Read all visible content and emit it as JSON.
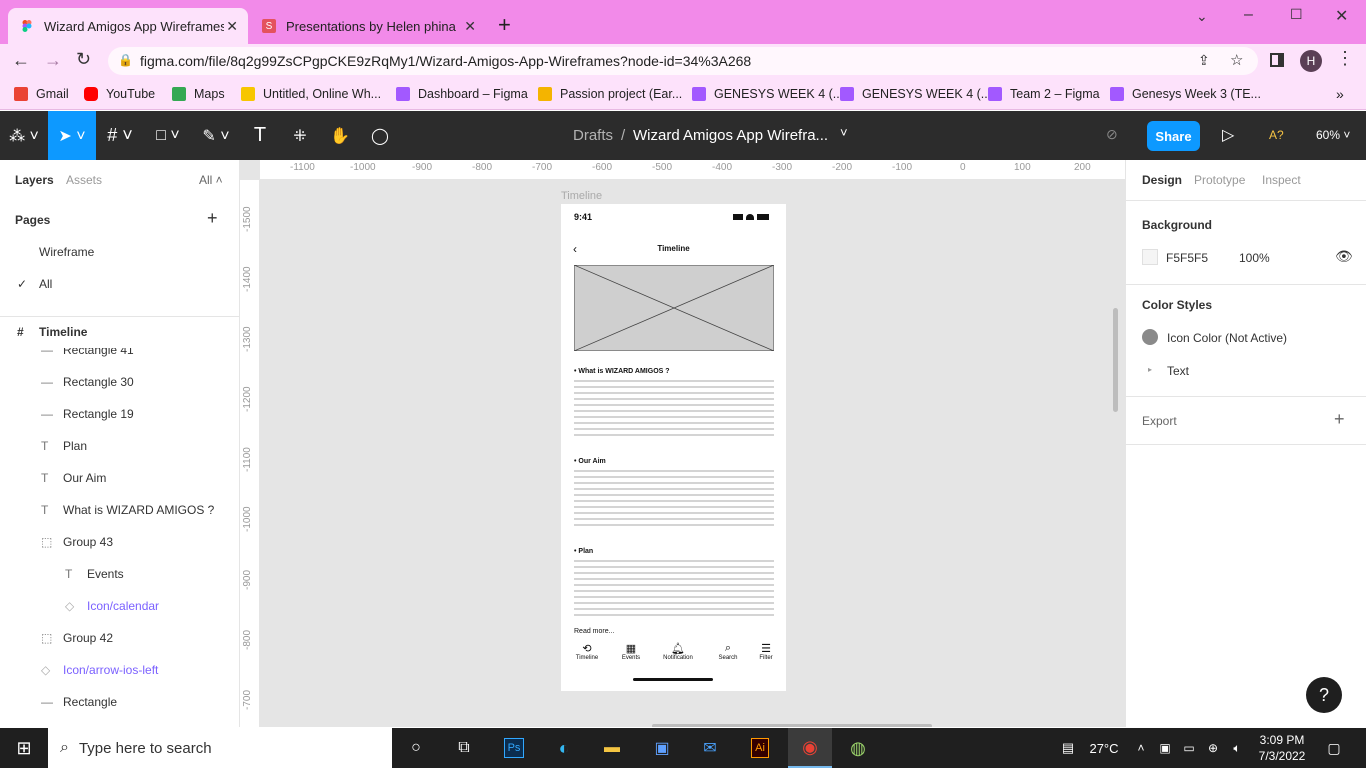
{
  "browser": {
    "tabs": [
      {
        "title": "Wizard Amigos App Wireframes"
      },
      {
        "title": "Presentations by Helen phina"
      }
    ],
    "new_tab": "+",
    "url": "figma.com/file/8q2g99ZsCPgpCKE9zRqMy1/Wizard-Amigos-App-Wireframes?node-id=34%3A268",
    "profile_initial": "H",
    "bookmarks": [
      {
        "label": "Gmail",
        "color": "#ea4335"
      },
      {
        "label": "YouTube",
        "color": "#ff0000"
      },
      {
        "label": "Maps",
        "color": "#34a853"
      },
      {
        "label": "Untitled, Online Wh...",
        "color": "#f7c600"
      },
      {
        "label": "Dashboard – Figma",
        "color": "#a259ff"
      },
      {
        "label": "Passion project (Ear...",
        "color": "#f4b400"
      },
      {
        "label": "GENESYS WEEK 4 (...",
        "color": "#a259ff"
      },
      {
        "label": "GENESYS WEEK 4 (...",
        "color": "#a259ff"
      },
      {
        "label": "Team 2 – Figma",
        "color": "#a259ff"
      },
      {
        "label": "Genesys Week 3 (TE...",
        "color": "#a259ff"
      }
    ]
  },
  "figma": {
    "breadcrumb_root": "Drafts",
    "breadcrumb_sep": "/",
    "file_name": "Wizard Amigos App Wirefra...",
    "share_label": "Share",
    "ai_label": "A?",
    "zoom": "60%"
  },
  "left_panel": {
    "tabs": [
      "Layers",
      "Assets"
    ],
    "all_label": "All",
    "pages_label": "Pages",
    "pages": [
      {
        "label": "Wireframe",
        "checked": false
      },
      {
        "label": "All",
        "checked": true
      }
    ],
    "frame_label": "Timeline",
    "layers": [
      {
        "label": "Rectangle 41",
        "icon": "line",
        "indent": 0,
        "component": false
      },
      {
        "label": "Rectangle 30",
        "icon": "line",
        "indent": 0,
        "component": false
      },
      {
        "label": "Rectangle 19",
        "icon": "line",
        "indent": 0,
        "component": false
      },
      {
        "label": "Plan",
        "icon": "text",
        "indent": 0,
        "component": false
      },
      {
        "label": "Our Aim",
        "icon": "text",
        "indent": 0,
        "component": false
      },
      {
        "label": "What is WIZARD AMIGOS ?",
        "icon": "text",
        "indent": 0,
        "component": false
      },
      {
        "label": "Group 43",
        "icon": "group",
        "indent": 0,
        "component": false
      },
      {
        "label": "Events",
        "icon": "text",
        "indent": 1,
        "component": false
      },
      {
        "label": "Icon/calendar",
        "icon": "component",
        "indent": 1,
        "component": true
      },
      {
        "label": "Group 42",
        "icon": "group",
        "indent": 0,
        "component": false
      },
      {
        "label": "Icon/arrow-ios-left",
        "icon": "component",
        "indent": 0,
        "component": true
      },
      {
        "label": "Rectangle",
        "icon": "line",
        "indent": 0,
        "component": false
      }
    ]
  },
  "canvas": {
    "ruler_top": [
      "-1100",
      "-1000",
      "-900",
      "-800",
      "-700",
      "-600",
      "-500",
      "-400",
      "-300",
      "-200",
      "-100",
      "0",
      "100",
      "200"
    ],
    "ruler_left": [
      "-1500",
      "-1400",
      "-1300",
      "-1200",
      "-1100",
      "-1000",
      "-900",
      "-800",
      "-700"
    ],
    "frame_name": "Timeline",
    "phone": {
      "time": "9:41",
      "title": "Timeline",
      "sections": [
        "What is WIZARD AMIGOS ?",
        "Our Aim",
        "Plan"
      ],
      "read_more": "Read more...",
      "nav": [
        "Timeline",
        "Events",
        "Notification",
        "Search",
        "Filter"
      ]
    }
  },
  "right_panel": {
    "tabs": [
      "Design",
      "Prototype",
      "Inspect"
    ],
    "background_label": "Background",
    "bg_hex": "F5F5F5",
    "bg_opacity": "100%",
    "color_styles_label": "Color Styles",
    "styles": [
      {
        "label": "Icon Color (Not Active)",
        "color": "#8a8a8a"
      },
      {
        "label": "Text",
        "color": ""
      }
    ],
    "export_label": "Export",
    "help": "?"
  },
  "taskbar": {
    "search_placeholder": "Type here to search",
    "temperature": "27°C",
    "time": "3:09 PM",
    "date": "7/3/2022"
  }
}
